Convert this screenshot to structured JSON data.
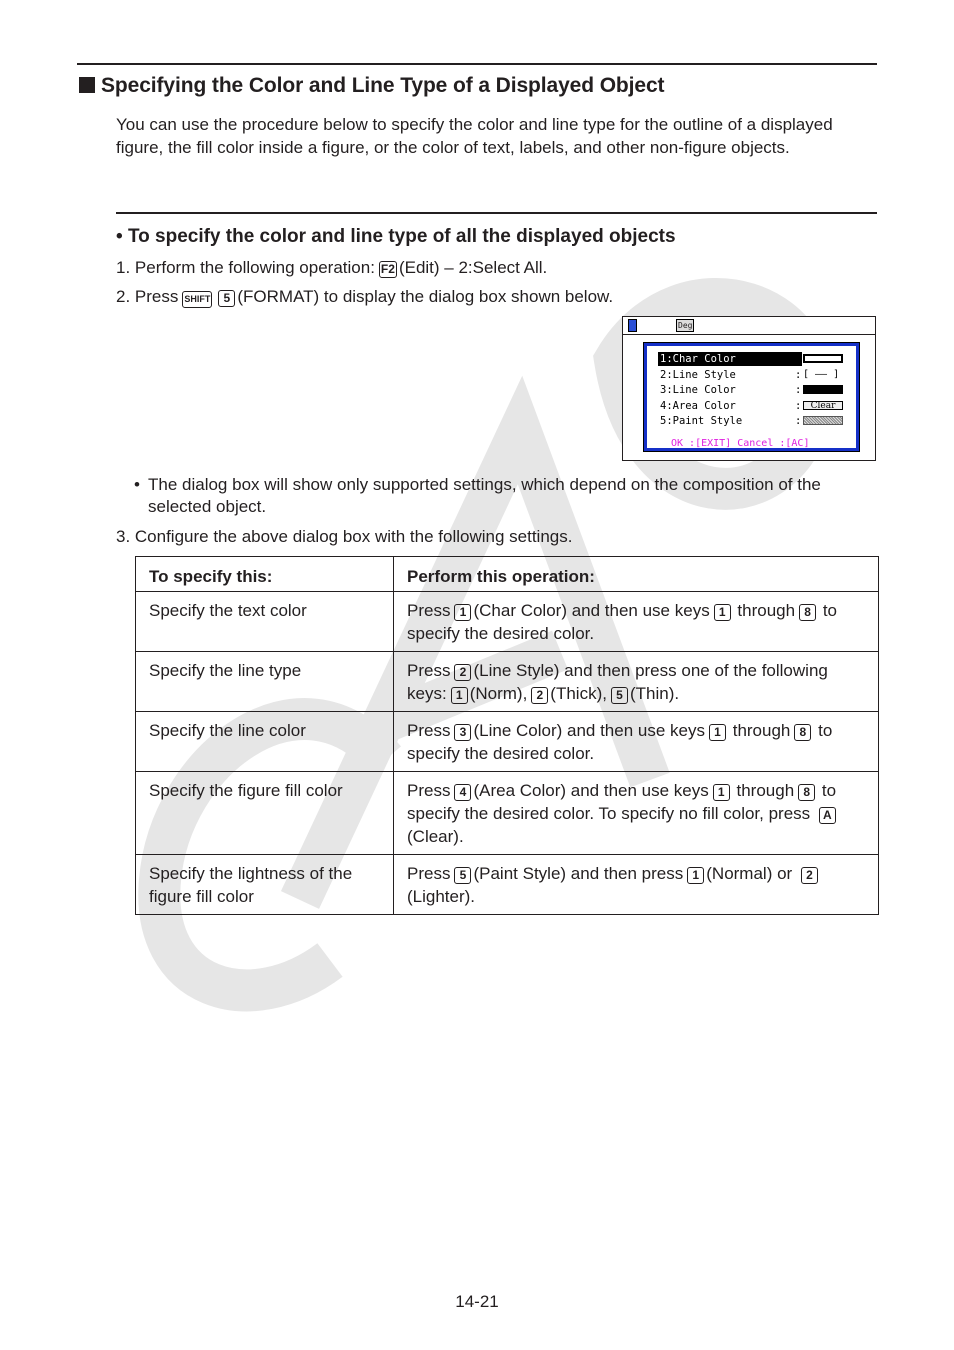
{
  "section": {
    "title": "Specifying the Color and Line Type of a Displayed Object",
    "intro": "You can use the procedure below to specify the color and line type for the outline of a displayed figure, the fill color inside a figure, or the color of text, labels, and other non-figure objects."
  },
  "subsection": {
    "title": "To specify the color and line type of all the displayed objects",
    "bullet": "•"
  },
  "steps": {
    "step1": {
      "prefix": "1. Perform the following operation:",
      "key": "F2",
      "suffix": "(Edit) – 2:Select All."
    },
    "step2": {
      "prefix": "2. Press",
      "key1": "SHIFT",
      "key2": "5",
      "suffix": "(FORMAT) to display the dialog box shown below."
    },
    "note": {
      "bullet": "•",
      "text": "The dialog box will show only supported settings, which depend on the composition of the selected object."
    },
    "step3": {
      "text": "3. Configure the above dialog box with the following settings."
    }
  },
  "calculator_screen": {
    "status_mode": "Deg",
    "dialog_items": [
      {
        "label": "1:Char Color",
        "separator": ":",
        "value_type": "color-swatch",
        "selected": true
      },
      {
        "label": "2:Line Style",
        "separator": ":",
        "value_text": "[ —— ]"
      },
      {
        "label": "3:Line Color",
        "separator": ":",
        "value_type": "color-swatch"
      },
      {
        "label": "4:Area Color",
        "separator": ":",
        "value_text": "Clear"
      },
      {
        "label": "5:Paint Style",
        "separator": ":",
        "value_type": "pattern"
      }
    ],
    "footer": "OK :[EXIT]  Cancel :[AC]",
    "colors": {
      "dialog_border": "#1530c8",
      "footer_text": "#e020e0",
      "battery": "#2a4fd6"
    }
  },
  "table": {
    "headers": [
      "To specify this:",
      "Perform this operation:"
    ],
    "rows": [
      {
        "what": "Specify the text color",
        "op": [
          {
            "t": "Press"
          },
          {
            "k": "1"
          },
          {
            "t": "(Char Color) and then use keys"
          },
          {
            "k": "1"
          },
          {
            "t": " through"
          },
          {
            "k": "8"
          },
          {
            "t": " to specify the desired color."
          }
        ]
      },
      {
        "what": "Specify the line type",
        "op": [
          {
            "t": "Press"
          },
          {
            "k": "2"
          },
          {
            "t": "(Line Style) and then press one of the following keys:"
          },
          {
            "k": "1"
          },
          {
            "t": "(Norm),"
          },
          {
            "k": "2"
          },
          {
            "t": "(Thick),"
          },
          {
            "k": "5"
          },
          {
            "t": "(Thin)."
          }
        ]
      },
      {
        "what": "Specify the line color",
        "op": [
          {
            "t": "Press"
          },
          {
            "k": "3"
          },
          {
            "t": "(Line Color) and then use keys"
          },
          {
            "k": "1"
          },
          {
            "t": " through"
          },
          {
            "k": "8"
          },
          {
            "t": " to specify the desired color."
          }
        ]
      },
      {
        "what": "Specify the figure fill color",
        "op": [
          {
            "t": "Press"
          },
          {
            "k": "4"
          },
          {
            "t": "(Area Color) and then use keys"
          },
          {
            "k": "1"
          },
          {
            "t": " through"
          },
          {
            "k": "8"
          },
          {
            "t": " to specify the desired color. To specify no fill color, press "
          },
          {
            "k": "A"
          },
          {
            "t": "(Clear)."
          }
        ]
      },
      {
        "what": "Specify the lightness of the figure fill color",
        "op": [
          {
            "t": "Press"
          },
          {
            "k": "5"
          },
          {
            "t": "(Paint Style) and then press"
          },
          {
            "k": "1"
          },
          {
            "t": "(Normal) or "
          },
          {
            "k": "2"
          },
          {
            "t": "(Lighter)."
          }
        ]
      }
    ]
  },
  "footer": {
    "page_number": "14-21"
  },
  "watermark": {
    "text": "CASIO",
    "color": "#e6e6e6"
  }
}
